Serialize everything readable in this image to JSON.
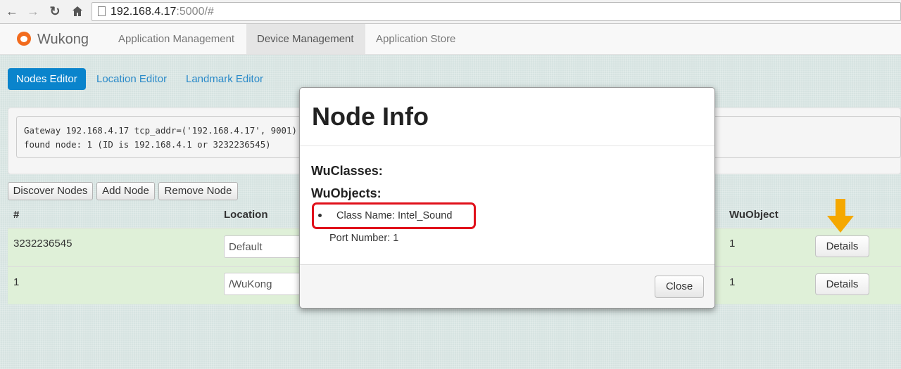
{
  "browser": {
    "url_host": "192.168.4.17",
    "url_rest": ":5000/#"
  },
  "navbar": {
    "brand": "Wukong",
    "tabs": [
      {
        "label": "Application Management"
      },
      {
        "label": "Device Management",
        "active": true
      },
      {
        "label": "Application Store"
      }
    ]
  },
  "subnav": {
    "tabs": [
      {
        "label": "Nodes Editor",
        "active": true
      },
      {
        "label": "Location Editor"
      },
      {
        "label": "Landmark Editor"
      }
    ]
  },
  "log": {
    "text": "Gateway 192.168.4.17 tcp_addr=('192.168.4.17', 9001)\nfound node: 1 (ID is 192.168.4.1 or 3232236545)"
  },
  "actions": {
    "discover": "Discover Nodes",
    "add": "Add Node",
    "remove": "Remove Node"
  },
  "table": {
    "headers": {
      "id": "#",
      "location": "Location",
      "wuobject": "WuObject"
    },
    "rows": [
      {
        "id": "3232236545",
        "location": "Default",
        "wuobject": "1",
        "details": "Details"
      },
      {
        "id": "1",
        "location": "/WuKong",
        "wuobject": "1",
        "details": "Details"
      }
    ]
  },
  "modal": {
    "title": "Node Info",
    "wuclasses_heading": "WuClasses:",
    "wuobjects_heading": "WuObjects:",
    "class_name": "Class Name: Intel_Sound",
    "port_number": "Port Number: 1",
    "close": "Close"
  },
  "colors": {
    "primary": "#0a84cc",
    "row_success": "#dff0d8",
    "highlight": "#e0101a",
    "arrow": "#f5a800"
  }
}
